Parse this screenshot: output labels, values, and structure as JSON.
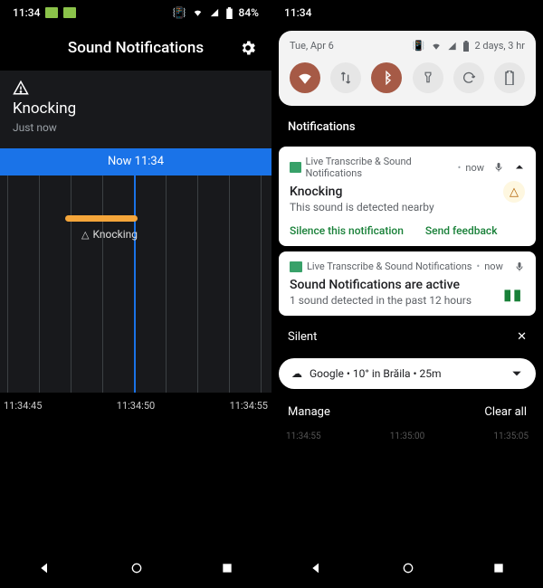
{
  "left": {
    "status": {
      "time": "11:34",
      "battery": "84%"
    },
    "header": {
      "title": "Sound Notifications"
    },
    "event": {
      "name": "Knocking",
      "time": "Just now"
    },
    "now_bar": "Now 11:34",
    "timeline_label": "Knocking",
    "axis": [
      "11:34:45",
      "11:34:50",
      "11:34:55"
    ]
  },
  "right": {
    "status": {
      "time": "11:34"
    },
    "qs": {
      "date": "Tue, Apr 6",
      "battery_text": "2 days, 3 hr",
      "tiles": [
        "wifi",
        "data",
        "bluetooth",
        "flashlight",
        "rotate",
        "battery-saver"
      ]
    },
    "section_notifications": "Notifications",
    "notif1": {
      "app": "Live Transcribe & Sound Notifications",
      "ago": "now",
      "title": "Knocking",
      "body": "This sound is detected nearby",
      "action1": "Silence this notification",
      "action2": "Send feedback"
    },
    "notif2": {
      "app": "Live Transcribe & Sound Notifications",
      "ago": "now",
      "title": "Sound Notifications are active",
      "body": "1 sound detected in the past 12 hours"
    },
    "silent_label": "Silent",
    "google_card": "Google  •  10° in Brăila  •  25m",
    "manage": "Manage",
    "clear_all": "Clear all",
    "faint_axis": [
      "11:34:55",
      "11:35:00",
      "11:35:05"
    ]
  }
}
